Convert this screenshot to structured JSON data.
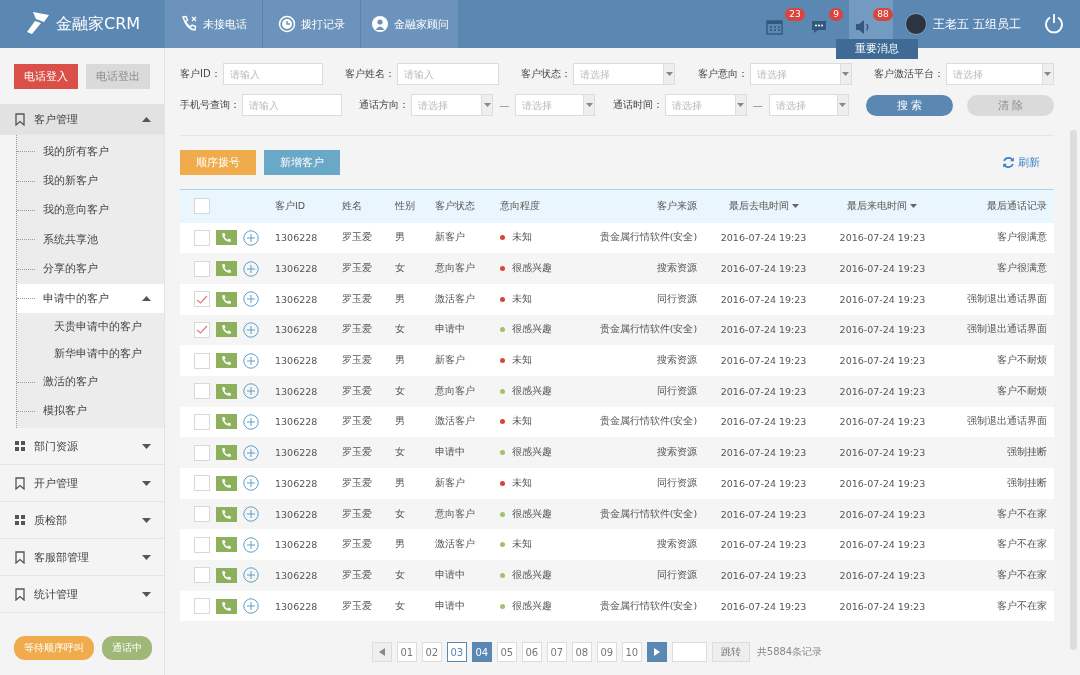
{
  "header": {
    "logo": "金融家CRM",
    "nav": [
      {
        "label": "未接电话",
        "kind": "missed"
      },
      {
        "label": "拨打记录",
        "kind": "clock"
      },
      {
        "label": "金融家顾问",
        "kind": "advisor"
      }
    ],
    "notifications": [
      {
        "kind": "calendar",
        "count": "23",
        "selected": false
      },
      {
        "kind": "chat",
        "count": "9",
        "selected": false
      },
      {
        "kind": "speaker",
        "count": "88",
        "selected": true
      }
    ],
    "tooltip": "重要消息",
    "user": "王老五 五组员工"
  },
  "sidebar": {
    "buttons": [
      {
        "label": "电话登入",
        "disabled": false
      },
      {
        "label": "电话登出",
        "disabled": true
      }
    ],
    "groups": [
      {
        "label": "客户管理",
        "kind": "bookmark",
        "expanded": true,
        "children": [
          {
            "label": "我的所有客户",
            "selected": false
          },
          {
            "label": "我的新客户",
            "selected": false
          },
          {
            "label": "我的意向客户",
            "selected": false
          },
          {
            "label": "系统共享池",
            "selected": false
          },
          {
            "label": "分享的客户",
            "selected": false
          },
          {
            "label": "申请中的客户",
            "selected": true,
            "expanded": true,
            "children": [
              {
                "label": "天贵申请中的客户",
                "selected": false
              },
              {
                "label": "新华申请中的客户",
                "selected": false
              }
            ]
          },
          {
            "label": "激活的客户",
            "selected": false
          },
          {
            "label": "模拟客户",
            "selected": false
          }
        ]
      },
      {
        "label": "部门资源",
        "kind": "grid",
        "expanded": false
      },
      {
        "label": "开户管理",
        "kind": "bookmark",
        "expanded": false
      },
      {
        "label": "质检部",
        "kind": "grid",
        "expanded": false
      },
      {
        "label": "客服部管理",
        "kind": "bookmark",
        "expanded": false
      },
      {
        "label": "统计管理",
        "kind": "bookmark",
        "expanded": false
      }
    ],
    "status": [
      {
        "label": "等待顺序呼叫",
        "color": "#f0ac4c"
      },
      {
        "label": "通话中",
        "color": "#9fb878"
      }
    ]
  },
  "filters": [
    [
      {
        "label": "客户ID：",
        "kind": "text",
        "placeholder": "请输入"
      },
      {
        "label": "客户姓名：",
        "kind": "text",
        "placeholder": "请输入"
      },
      {
        "label": "客户状态：",
        "kind": "select",
        "placeholder": "请选择"
      },
      {
        "label": "客户意向：",
        "kind": "select",
        "placeholder": "请选择"
      },
      {
        "label": "客户激活平台：",
        "kind": "select",
        "placeholder": "请选择"
      }
    ],
    [
      {
        "label": "手机号查询：",
        "kind": "text",
        "placeholder": "请输入"
      },
      {
        "label": "通话方向：",
        "kind": "range",
        "placeholder": "请选择",
        "placeholder_end": "请选择",
        "dash": "—"
      },
      {
        "label": "通话时间：",
        "kind": "range",
        "placeholder": "请选择",
        "placeholder_end": "请选择",
        "dash": "—"
      }
    ]
  ],
  "filter_buttons": [
    {
      "label": "搜 索",
      "disabled": false
    },
    {
      "label": "清 除",
      "disabled": true
    }
  ],
  "actions": [
    {
      "label": "顺序拨号",
      "kind": "orange"
    },
    {
      "label": "新增客户",
      "kind": "blue"
    }
  ],
  "refresh": "刷新",
  "table": {
    "columns": [
      {
        "label": "客户ID",
        "sortable": false
      },
      {
        "label": "姓名",
        "sortable": false
      },
      {
        "label": "性别",
        "sortable": false
      },
      {
        "label": "客户状态",
        "sortable": false
      },
      {
        "label": "意向程度",
        "sortable": false
      },
      {
        "label": "客户来源",
        "sortable": false
      },
      {
        "label": "最后去电时间",
        "sortable": true
      },
      {
        "label": "最后来电时间",
        "sortable": true
      },
      {
        "label": "最后通话记录",
        "sortable": false
      }
    ],
    "header_checked": false,
    "rows": [
      {
        "checked": false,
        "cells": [
          "1306228",
          "罗玉爱",
          "男",
          "新客户",
          "未知",
          "贵金属行情软件(安全)",
          "2016-07-24 19:23",
          "2016-07-24 19:23",
          "客户很满意"
        ],
        "color": "#d9453c"
      },
      {
        "checked": false,
        "cells": [
          "1306228",
          "罗玉爱",
          "女",
          "意向客户",
          "很感兴趣",
          "搜索资源",
          "2016-07-24 19:23",
          "2016-07-24 19:23",
          "客户很满意"
        ],
        "color": "#d9453c"
      },
      {
        "checked": true,
        "cells": [
          "1306228",
          "罗玉爱",
          "男",
          "激活客户",
          "未知",
          "同行资源",
          "2016-07-24 19:23",
          "2016-07-24 19:23",
          "强制退出通话界面"
        ],
        "color": "#d9453c"
      },
      {
        "checked": true,
        "cells": [
          "1306228",
          "罗玉爱",
          "女",
          "申请中",
          "很感兴趣",
          "贵金属行情软件(安全)",
          "2016-07-24 19:23",
          "2016-07-24 19:23",
          "强制退出通话界面"
        ],
        "color": "#9fc26a"
      },
      {
        "checked": false,
        "cells": [
          "1306228",
          "罗玉爱",
          "男",
          "新客户",
          "未知",
          "搜索资源",
          "2016-07-24 19:23",
          "2016-07-24 19:23",
          "客户不耐烦"
        ],
        "color": "#d9453c"
      },
      {
        "checked": false,
        "cells": [
          "1306228",
          "罗玉爱",
          "女",
          "意向客户",
          "很感兴趣",
          "同行资源",
          "2016-07-24 19:23",
          "2016-07-24 19:23",
          "客户不耐烦"
        ],
        "color": "#9fc26a"
      },
      {
        "checked": false,
        "cells": [
          "1306228",
          "罗玉爱",
          "男",
          "激活客户",
          "未知",
          "贵金属行情软件(安全)",
          "2016-07-24 19:23",
          "2016-07-24 19:23",
          "强制退出通话界面"
        ],
        "color": "#d9453c"
      },
      {
        "checked": false,
        "cells": [
          "1306228",
          "罗玉爱",
          "女",
          "申请中",
          "很感兴趣",
          "搜索资源",
          "2016-07-24 19:23",
          "2016-07-24 19:23",
          "强制挂断"
        ],
        "color": "#9fc26a"
      },
      {
        "checked": false,
        "cells": [
          "1306228",
          "罗玉爱",
          "男",
          "新客户",
          "未知",
          "同行资源",
          "2016-07-24 19:23",
          "2016-07-24 19:23",
          "强制挂断"
        ],
        "color": "#d9453c"
      },
      {
        "checked": false,
        "cells": [
          "1306228",
          "罗玉爱",
          "女",
          "意向客户",
          "很感兴趣",
          "贵金属行情软件(安全)",
          "2016-07-24 19:23",
          "2016-07-24 19:23",
          "客户不在家"
        ],
        "color": "#9fc26a"
      },
      {
        "checked": false,
        "cells": [
          "1306228",
          "罗玉爱",
          "男",
          "激活客户",
          "未知",
          "搜索资源",
          "2016-07-24 19:23",
          "2016-07-24 19:23",
          "客户不在家"
        ],
        "color": "#9fc26a"
      },
      {
        "checked": false,
        "cells": [
          "1306228",
          "罗玉爱",
          "女",
          "申请中",
          "很感兴趣",
          "同行资源",
          "2016-07-24 19:23",
          "2016-07-24 19:23",
          "客户不在家"
        ],
        "color": "#9fc26a"
      },
      {
        "checked": false,
        "cells": [
          "1306228",
          "罗玉爱",
          "女",
          "申请中",
          "很感兴趣",
          "贵金属行情软件(安全)",
          "2016-07-24 19:23",
          "2016-07-24 19:23",
          "客户不在家"
        ],
        "color": "#9fc26a"
      }
    ]
  },
  "pagination": {
    "pages": [
      {
        "label": "01",
        "selected": false,
        "focused": false
      },
      {
        "label": "02",
        "selected": false,
        "focused": false
      },
      {
        "label": "03",
        "selected": false,
        "focused": true
      },
      {
        "label": "04",
        "selected": true,
        "focused": false
      },
      {
        "label": "05",
        "selected": false,
        "focused": false
      },
      {
        "label": "06",
        "selected": false,
        "focused": false
      },
      {
        "label": "07",
        "selected": false,
        "focused": false
      },
      {
        "label": "08",
        "selected": false,
        "focused": false
      },
      {
        "label": "09",
        "selected": false,
        "focused": false
      },
      {
        "label": "10",
        "selected": false,
        "focused": false
      }
    ],
    "jump": "跳转",
    "total": "共5884条记录"
  }
}
